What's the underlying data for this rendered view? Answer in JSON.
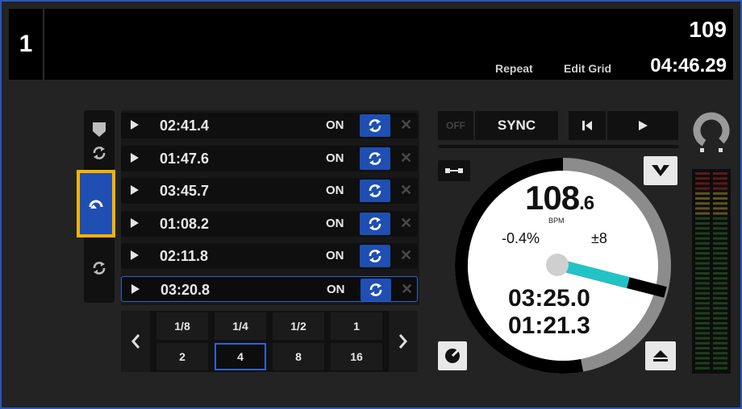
{
  "deck": {
    "number": "1",
    "bpm": "109",
    "links": {
      "repeat": "Repeat",
      "edit_grid": "Edit Grid"
    },
    "time": "04:46.29"
  },
  "loops": [
    {
      "time": "02:41.4",
      "on": "ON",
      "selected": false
    },
    {
      "time": "01:47.6",
      "on": "ON",
      "selected": false
    },
    {
      "time": "03:45.7",
      "on": "ON",
      "selected": false
    },
    {
      "time": "01:08.2",
      "on": "ON",
      "selected": false
    },
    {
      "time": "02:11.8",
      "on": "ON",
      "selected": false
    },
    {
      "time": "03:20.8",
      "on": "ON",
      "selected": true
    }
  ],
  "loop_lengths": {
    "row1": [
      "1/8",
      "1/4",
      "1/2",
      "1"
    ],
    "row2": [
      "2",
      "4",
      "8",
      "16"
    ],
    "selected": "4"
  },
  "transport": {
    "off": "OFF",
    "sync": "SYNC"
  },
  "platter": {
    "bpm_int": "108",
    "bpm_dec": ".6",
    "bpm_label": "BPM",
    "pitch": "-0.4%",
    "range": "±8",
    "time_elapsed": "03:25.0",
    "time_remaining": "01:21.3",
    "progress": 0.53
  },
  "colors": {
    "accent_blue": "#1f4fb2",
    "highlight": "#f5b400",
    "needle": "#22c3c7"
  },
  "icons": {
    "hotcue": "tag-icon",
    "loop": "loop-icon",
    "roll": "roll-icon",
    "slip": "loop-icon",
    "prev": "skip-back-icon",
    "play": "play-icon",
    "keylock": "keylock-icon",
    "tempo": "tempo-icon",
    "eject": "eject-icon"
  }
}
